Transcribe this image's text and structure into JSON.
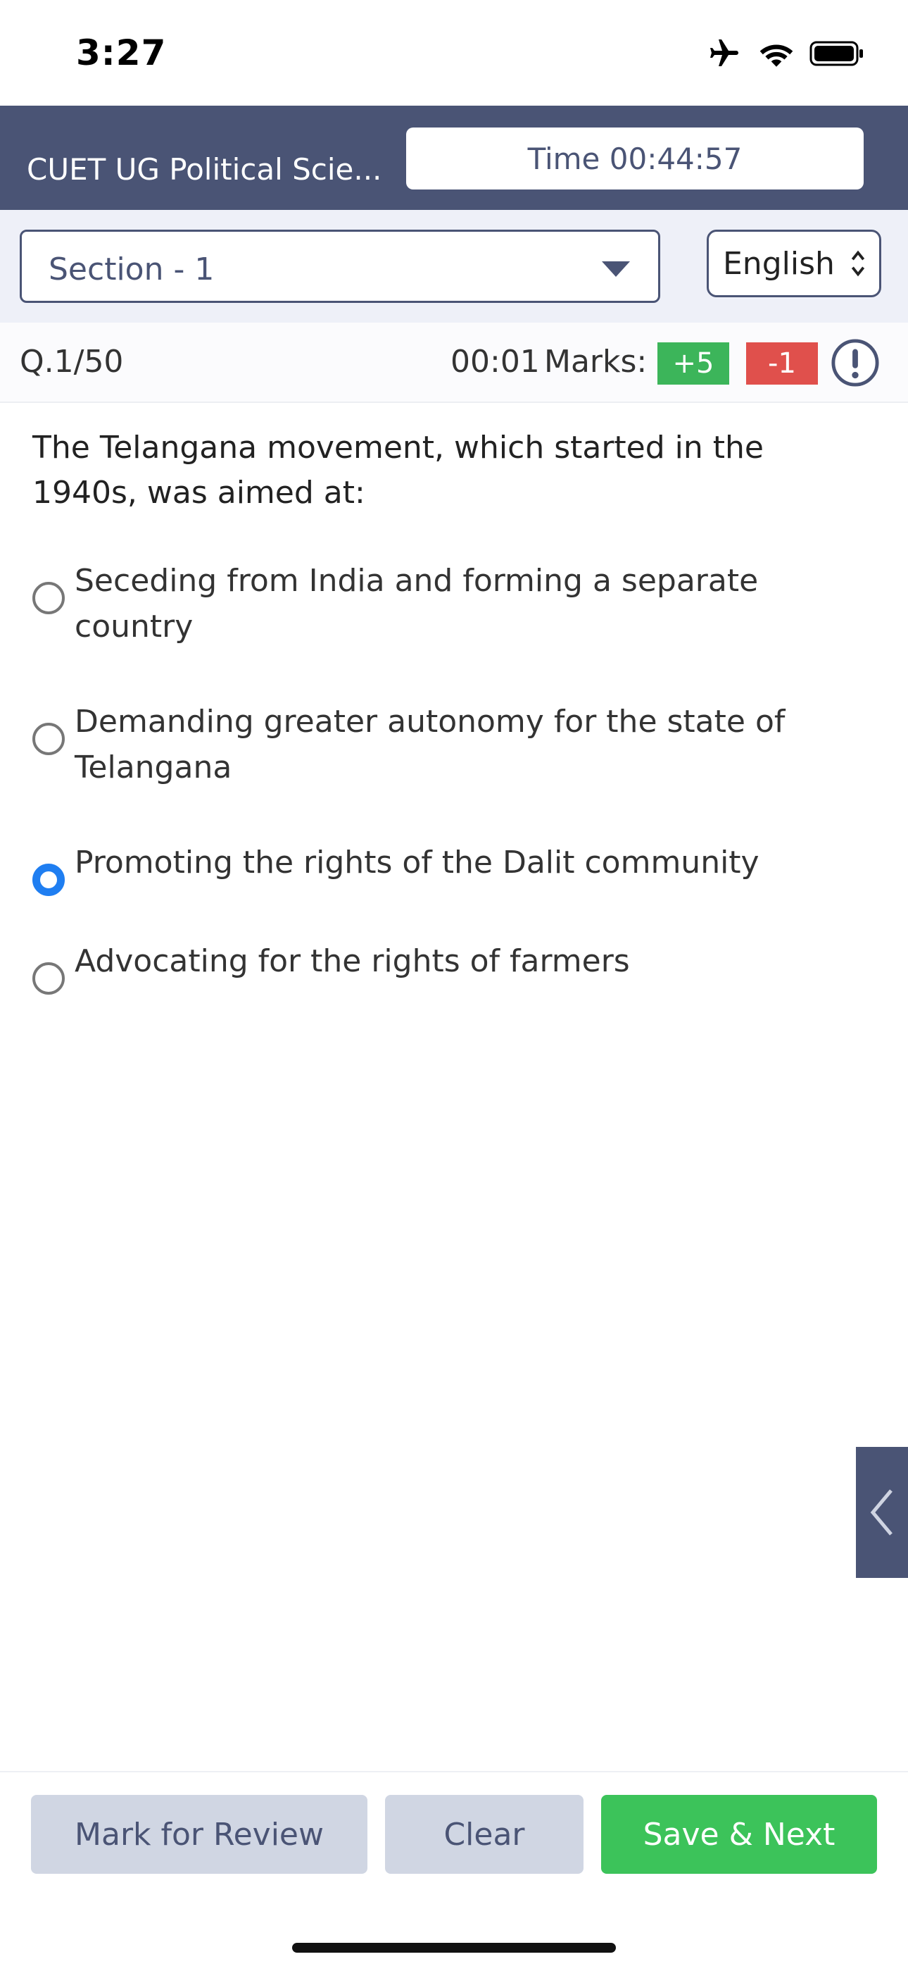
{
  "status_bar": {
    "time": "3:27"
  },
  "header": {
    "exam_title": "CUET UG Political Scie...",
    "timer": "Time 00:44:57",
    "color": "#4a5475"
  },
  "section": {
    "selected": "Section - 1"
  },
  "language": {
    "selected": "English"
  },
  "question_meta": {
    "number": "Q.1/50",
    "elapsed": "00:01",
    "marks_label": "Marks:",
    "positive": "+5",
    "negative": "-1"
  },
  "question": {
    "text": "The Telangana movement, which started in the 1940s, was aimed at:",
    "options": [
      {
        "label": "Seceding from India and forming a separate country",
        "selected": false
      },
      {
        "label": "Demanding greater autonomy for the state of Telangana",
        "selected": false
      },
      {
        "label": "Promoting the rights of the Dalit community",
        "selected": true
      },
      {
        "label": "Advocating for the rights of farmers",
        "selected": false
      }
    ]
  },
  "actions": {
    "mark_review": "Mark for Review",
    "clear": "Clear",
    "save_next": "Save & Next"
  },
  "colors": {
    "accent": "#1f7ef1",
    "positive": "#3cb55a",
    "negative": "#e0504c",
    "save": "#3cc35a"
  }
}
